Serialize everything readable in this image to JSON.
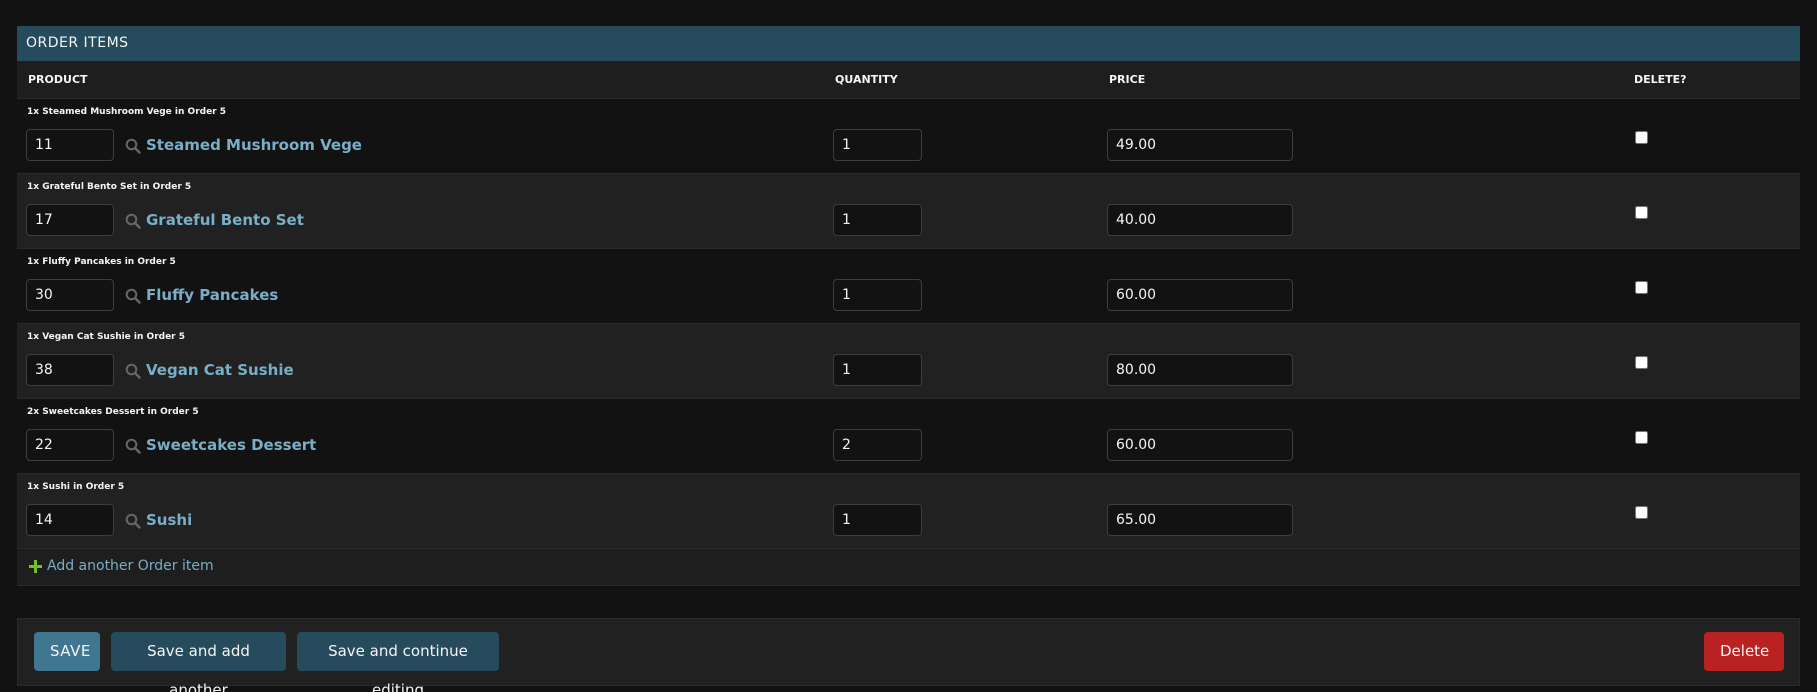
{
  "inline": {
    "title": "ORDER ITEMS",
    "columns": {
      "product": "PRODUCT",
      "quantity": "QUANTITY",
      "price": "PRICE",
      "delete": "DELETE?"
    },
    "rows": [
      {
        "caption": "1x Steamed Mushroom Vege in Order 5",
        "product_id": "11",
        "product_name": "Steamed Mushroom Vege",
        "quantity": "1",
        "price": "49.00",
        "delete": false
      },
      {
        "caption": "1x Grateful Bento Set in Order 5",
        "product_id": "17",
        "product_name": "Grateful Bento Set",
        "quantity": "1",
        "price": "40.00",
        "delete": false
      },
      {
        "caption": "1x Fluffy Pancakes in Order 5",
        "product_id": "30",
        "product_name": "Fluffy Pancakes",
        "quantity": "1",
        "price": "60.00",
        "delete": false
      },
      {
        "caption": "1x Vegan Cat Sushie in Order 5",
        "product_id": "38",
        "product_name": "Vegan Cat Sushie",
        "quantity": "1",
        "price": "80.00",
        "delete": false
      },
      {
        "caption": "2x Sweetcakes Dessert in Order 5",
        "product_id": "22",
        "product_name": "Sweetcakes Dessert",
        "quantity": "2",
        "price": "60.00",
        "delete": false
      },
      {
        "caption": "1x Sushi in Order 5",
        "product_id": "14",
        "product_name": "Sushi",
        "quantity": "1",
        "price": "65.00",
        "delete": false
      }
    ],
    "add_link": "Add another Order item",
    "icons": {
      "lookup": "search-icon",
      "add": "plus-icon"
    }
  },
  "submit": {
    "save": "SAVE",
    "save_add_another": "Save and add another",
    "save_continue": "Save and continue editing",
    "delete": "Delete"
  },
  "colors": {
    "header_bg": "#264b5d",
    "link": "#79aec8",
    "save_bg": "#417690",
    "secondary_bg": "#264b5d",
    "delete_bg": "#ba2121",
    "add_icon": "#70bf2b"
  }
}
